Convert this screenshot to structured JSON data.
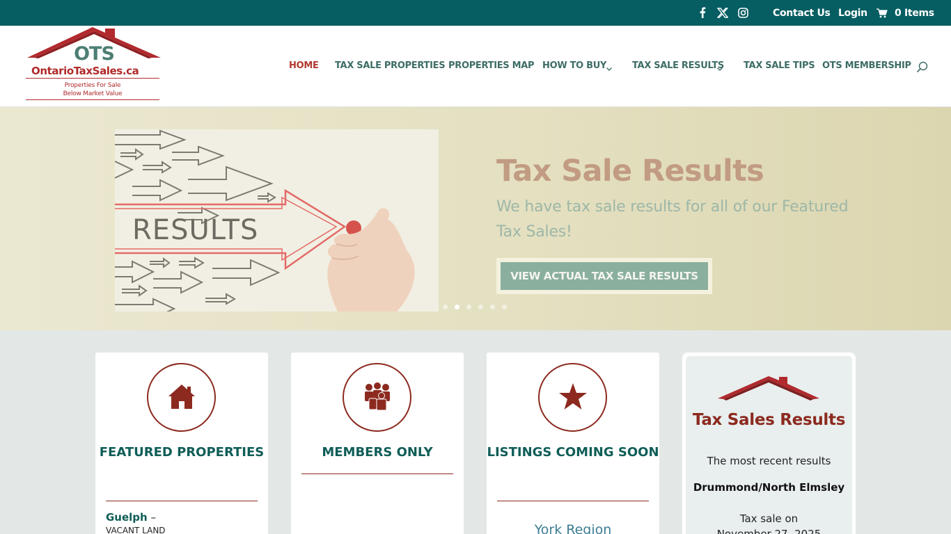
{
  "topbar": {
    "social": [
      "facebook-icon",
      "x-icon",
      "instagram-icon"
    ],
    "contact": "Contact Us",
    "login": "Login",
    "cart": "0 Items"
  },
  "logo": {
    "ots": "OTS",
    "site": "OntarioTaxSales.ca",
    "tagline1": "Properties For Sale",
    "tagline2": "Below Market Value"
  },
  "nav": {
    "items": [
      {
        "label": "HOME",
        "active": true
      },
      {
        "label": "TAX SALE PROPERTIES"
      },
      {
        "label": "PROPERTIES MAP"
      },
      {
        "label": "HOW TO BUY",
        "dropdown": true
      },
      {
        "label": "TAX SALE RESULTS",
        "dropdown": true
      },
      {
        "label": "TAX SALE TIPS"
      },
      {
        "label": "OTS MEMBERSHIP"
      }
    ]
  },
  "hero": {
    "image_text": "RESULTS",
    "title": "Tax Sale Results",
    "description": "We have tax sale results for all of our Featured Tax Sales!",
    "button": "VIEW ACTUAL TAX SALE RESULTS",
    "slide_count": 6,
    "active_slide": 2
  },
  "cards": [
    {
      "title": "FEATURED PROPERTIES",
      "icon": "house-icon",
      "location": "Guelph",
      "location_suffix": " –",
      "sub": "VACANT LAND"
    },
    {
      "title": "MEMBERS ONLY",
      "icon": "members-icon"
    },
    {
      "title": "LISTINGS COMING SOON",
      "icon": "star-icon",
      "region": "York Region"
    }
  ],
  "results": {
    "title": "Tax Sales Results",
    "subtitle": "The most recent results",
    "place": "Drummond/North Elmsley",
    "date_line1": "Tax sale on",
    "date_line2": "November 27, 2025"
  },
  "colors": {
    "topbar": "#075e62",
    "accent_red": "#8c2a1f",
    "teal_text": "#0f5d57"
  }
}
